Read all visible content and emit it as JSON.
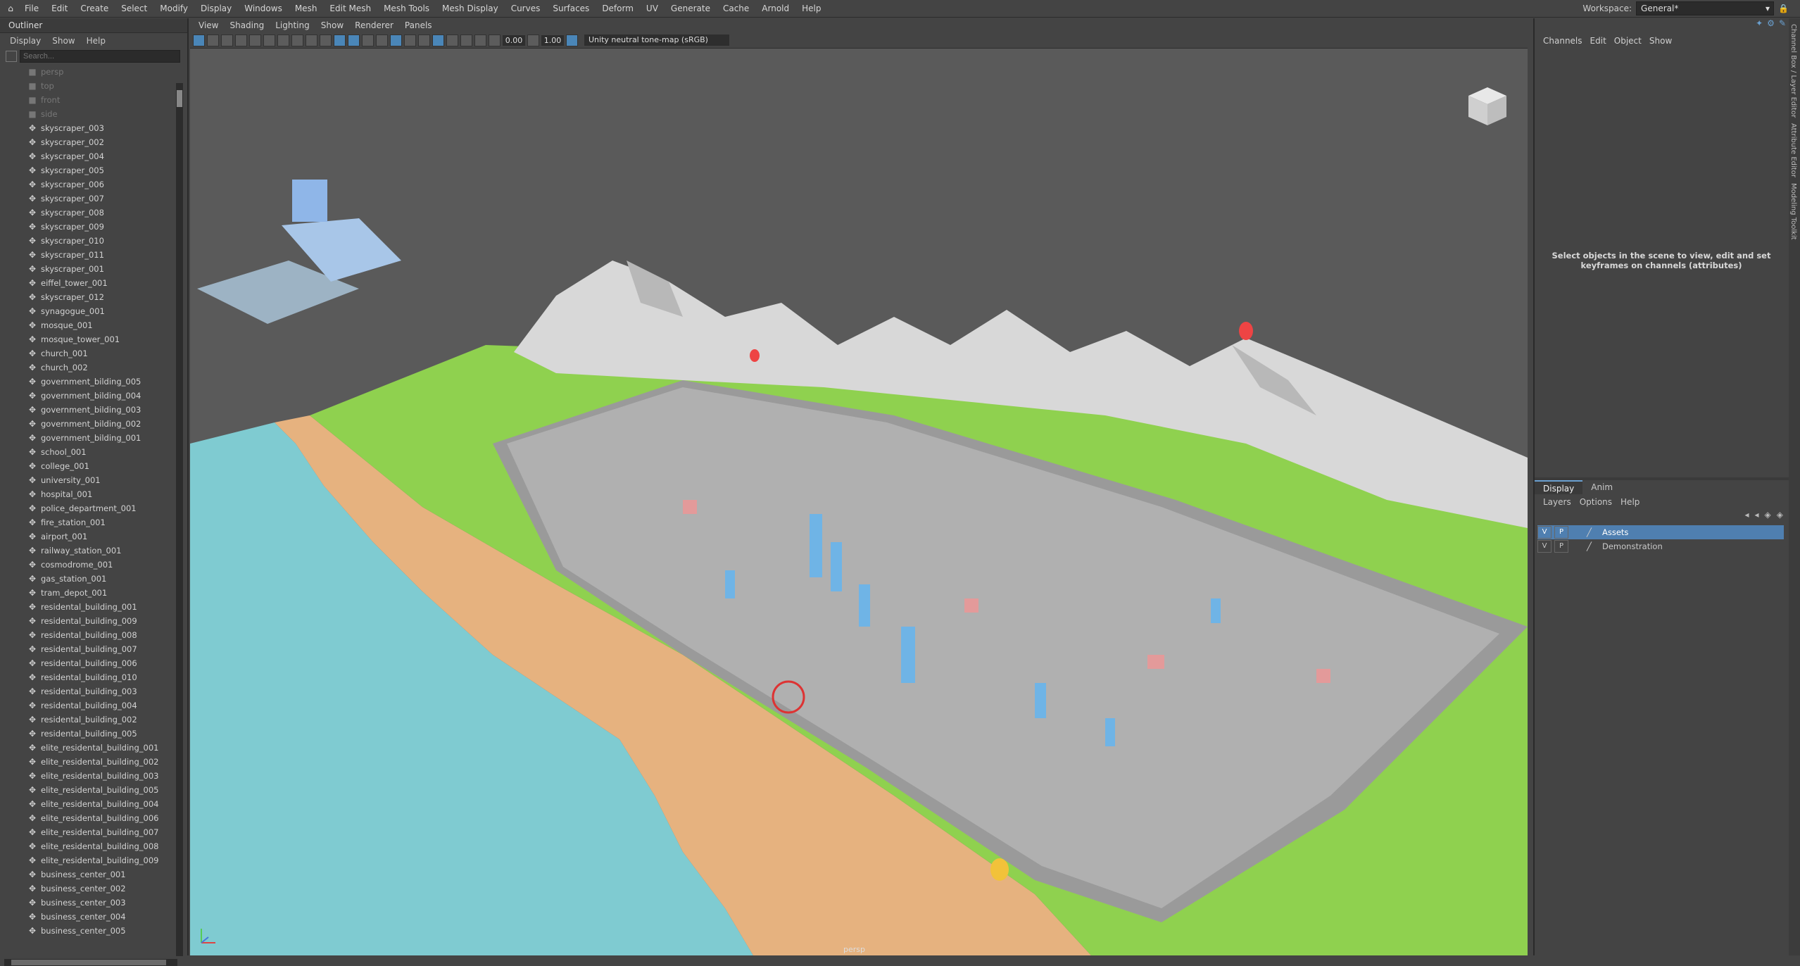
{
  "menubar": {
    "items": [
      "File",
      "Edit",
      "Create",
      "Select",
      "Modify",
      "Display",
      "Windows",
      "Mesh",
      "Edit Mesh",
      "Mesh Tools",
      "Mesh Display",
      "Curves",
      "Surfaces",
      "Deform",
      "UV",
      "Generate",
      "Cache",
      "Arnold",
      "Help"
    ],
    "workspace_label": "Workspace:",
    "workspace_value": "General*"
  },
  "outliner": {
    "title": "Outliner",
    "menu": [
      "Display",
      "Show",
      "Help"
    ],
    "search_placeholder": "Search...",
    "cameras": [
      "persp",
      "top",
      "front",
      "side"
    ],
    "items": [
      "skyscraper_003",
      "skyscraper_002",
      "skyscraper_004",
      "skyscraper_005",
      "skyscraper_006",
      "skyscraper_007",
      "skyscraper_008",
      "skyscraper_009",
      "skyscraper_010",
      "skyscraper_011",
      "skyscraper_001",
      "eiffel_tower_001",
      "skyscraper_012",
      "synagogue_001",
      "mosque_001",
      "mosque_tower_001",
      "church_001",
      "church_002",
      "government_bilding_005",
      "government_bilding_004",
      "government_bilding_003",
      "government_bilding_002",
      "government_bilding_001",
      "school_001",
      "college_001",
      "university_001",
      "hospital_001",
      "police_department_001",
      "fire_station_001",
      "airport_001",
      "railway_station_001",
      "cosmodrome_001",
      "gas_station_001",
      "tram_depot_001",
      "residental_building_001",
      "residental_building_009",
      "residental_building_008",
      "residental_building_007",
      "residental_building_006",
      "residental_building_010",
      "residental_building_003",
      "residental_building_004",
      "residental_building_002",
      "residental_building_005",
      "elite_residental_building_001",
      "elite_residental_building_002",
      "elite_residental_building_003",
      "elite_residental_building_005",
      "elite_residental_building_004",
      "elite_residental_building_006",
      "elite_residental_building_007",
      "elite_residental_building_008",
      "elite_residental_building_009",
      "business_center_001",
      "business_center_002",
      "business_center_003",
      "business_center_004",
      "business_center_005"
    ]
  },
  "viewport": {
    "menu": [
      "View",
      "Shading",
      "Lighting",
      "Show",
      "Renderer",
      "Panels"
    ],
    "exposure": "0.00",
    "gamma": "1.00",
    "colormgmt": "Unity neutral tone-map (sRGB)",
    "camera_label": "persp"
  },
  "channelbox": {
    "menu": [
      "Channels",
      "Edit",
      "Object",
      "Show"
    ],
    "message": "Select objects in the scene to view, edit and set keyframes on channels (attributes)"
  },
  "layers": {
    "tabs": [
      "Display",
      "Anim"
    ],
    "menu": [
      "Layers",
      "Options",
      "Help"
    ],
    "rows": [
      {
        "v": "V",
        "p": "P",
        "name": "Assets"
      },
      {
        "v": "V",
        "p": "P",
        "name": "Demonstration"
      }
    ]
  },
  "sidetabs": [
    "Channel Box / Layer Editor",
    "Attribute Editor",
    "Modeling Toolkit"
  ],
  "colors": {
    "accent": "#4f7fb0",
    "sea": "#7fcbd1",
    "sand": "#e6b27f",
    "grass": "#8fd14f",
    "mountain": "#d8d8d8"
  }
}
